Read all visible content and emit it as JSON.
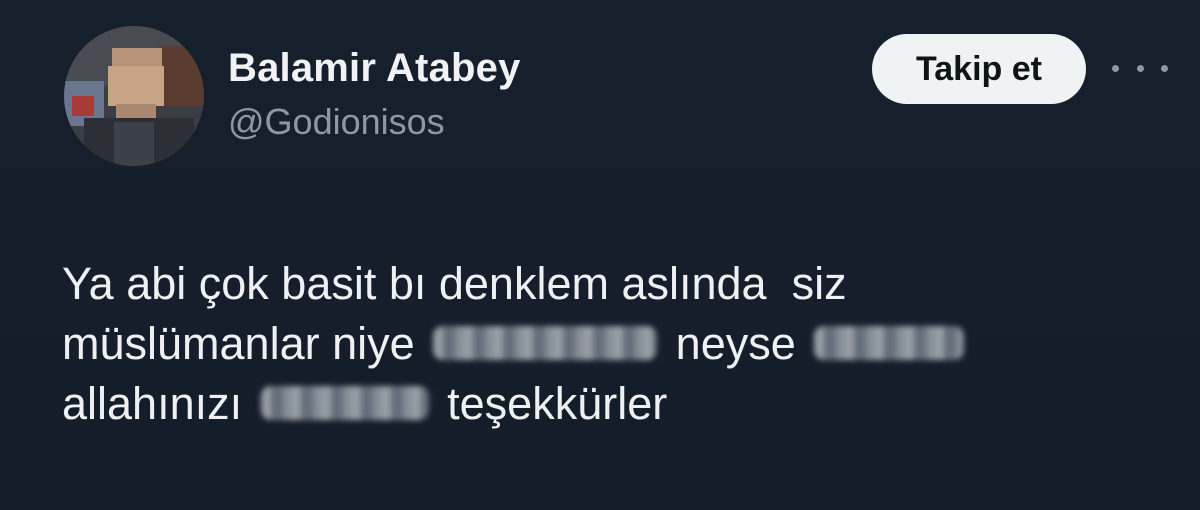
{
  "tweet": {
    "author": {
      "display_name": "Balamir Atabey",
      "handle": "@Godionisos"
    },
    "follow_label": "Takip et",
    "more_icon": "ellipsis-icon",
    "text": {
      "line1": "Ya abi çok basit bı denklem aslında  siz",
      "line2_a": "müslümanlar niye",
      "line2_b": "neyse",
      "line3_a": "allahınızı",
      "line3_b": "teşekkürler"
    }
  },
  "colors": {
    "background": "#15202b",
    "text": "#e7e9ea",
    "secondary_text": "#8b98a5",
    "button_bg": "#eff3f4"
  }
}
